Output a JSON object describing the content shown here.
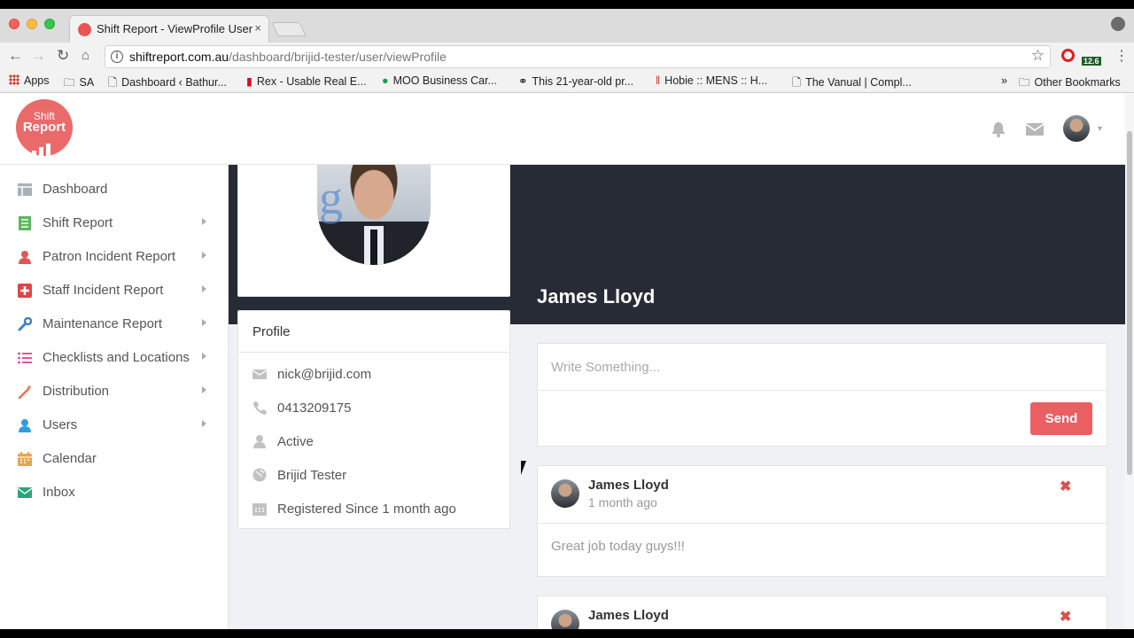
{
  "browser": {
    "tab_title": "Shift Report - ViewProfile User",
    "tab_close": "×",
    "url_host": "shiftreport.com.au",
    "url_path": "/dashboard/brijid-tester/user/viewProfile",
    "ext_badge": "12.6",
    "bookmarks": [
      "Apps",
      "SA",
      "Dashboard ‹ Bathur...",
      "Rex - Usable Real E...",
      "MOO Business Car...",
      "This 21-year-old pr...",
      "Hobie :: MENS :: H...",
      "The Vanual | Compl...",
      "»",
      "Other Bookmarks"
    ]
  },
  "logo": {
    "line1": "Shift",
    "line2": "Report"
  },
  "sidebar": {
    "items": [
      {
        "label": "Dashboard",
        "icon": "table-icon",
        "color": "#a9b0b8"
      },
      {
        "label": "Shift Report",
        "icon": "list-icon",
        "color": "#5cb85c"
      },
      {
        "label": "Patron Incident Report",
        "icon": "user-icon",
        "color": "#e05555"
      },
      {
        "label": "Staff Incident Report",
        "icon": "plus-square-icon",
        "color": "#e04444"
      },
      {
        "label": "Maintenance Report",
        "icon": "wrench-icon",
        "color": "#3a84c9"
      },
      {
        "label": "Checklists and Locations",
        "icon": "list-ul-icon",
        "color": "#e0569a"
      },
      {
        "label": "Distribution",
        "icon": "magic-wand-icon",
        "color": "#e8734a"
      },
      {
        "label": "Users",
        "icon": "user-icon",
        "color": "#2e9de0"
      },
      {
        "label": "Calendar",
        "icon": "calendar-icon",
        "color": "#e8a64a"
      },
      {
        "label": "Inbox",
        "icon": "envelope-icon",
        "color": "#2aa579"
      }
    ]
  },
  "profile": {
    "name": "James Lloyd",
    "section_title": "Profile",
    "email": "nick@brijid.com",
    "phone": "0413209175",
    "status": "Active",
    "company": "Brijid Tester",
    "registered": "Registered Since 1 month ago"
  },
  "composer": {
    "placeholder": "Write Something...",
    "send_label": "Send"
  },
  "posts": [
    {
      "author": "James Lloyd",
      "time": "1 month ago",
      "body": "Great job today guys!!!",
      "delete": "✖"
    },
    {
      "author": "James Lloyd",
      "delete": "✖"
    }
  ],
  "colors": {
    "accent": "#ea5f62",
    "cover": "#262b35"
  }
}
